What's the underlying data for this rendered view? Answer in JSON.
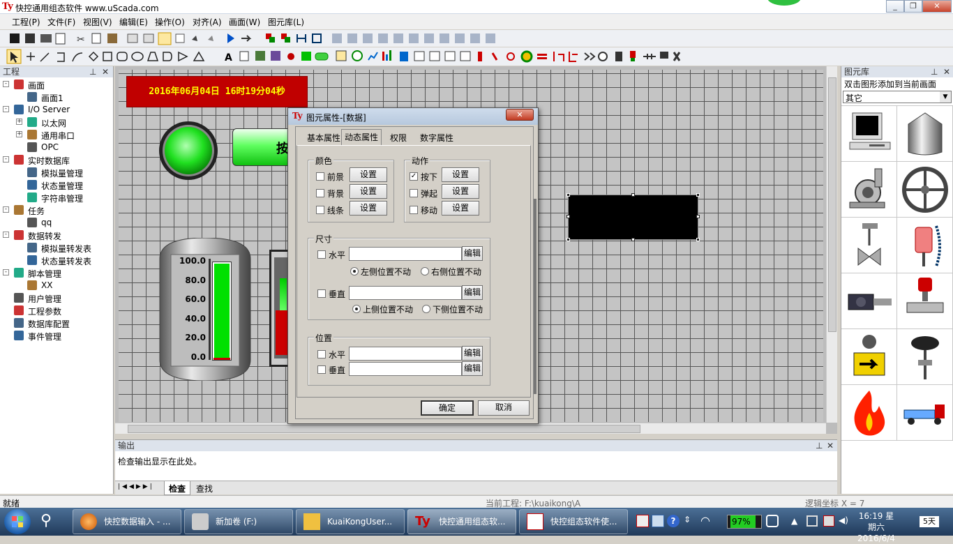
{
  "window": {
    "title": "快控通用组态软件 www.uScada.com"
  },
  "menu": [
    "工程(P)",
    "文件(F)",
    "视图(V)",
    "编辑(E)",
    "操作(O)",
    "对齐(A)",
    "画面(W)",
    "图元库(L)"
  ],
  "left_pane": {
    "title": "工程",
    "tree": [
      {
        "label": "画面",
        "level": 0,
        "expander": "-",
        "icon": "screen-icon"
      },
      {
        "label": "画面1",
        "level": 1,
        "expander": "",
        "icon": "page-icon"
      },
      {
        "label": "I/O Server",
        "level": 0,
        "expander": "-",
        "icon": "server-icon"
      },
      {
        "label": "以太网",
        "level": 1,
        "expander": "+",
        "icon": "network-icon"
      },
      {
        "label": "通用串口",
        "level": 1,
        "expander": "+",
        "icon": "serial-icon"
      },
      {
        "label": "OPC",
        "level": 1,
        "expander": "",
        "icon": "opc-icon"
      },
      {
        "label": "实时数据库",
        "level": 0,
        "expander": "-",
        "icon": "database-icon"
      },
      {
        "label": "模拟量管理",
        "level": 1,
        "expander": "",
        "icon": "analog-icon"
      },
      {
        "label": "状态量管理",
        "level": 1,
        "expander": "",
        "icon": "status-icon"
      },
      {
        "label": "字符串管理",
        "level": 1,
        "expander": "",
        "icon": "string-icon"
      },
      {
        "label": "任务",
        "level": 0,
        "expander": "-",
        "icon": "task-icon"
      },
      {
        "label": "qq",
        "level": 1,
        "expander": "",
        "icon": "qq-task-icon"
      },
      {
        "label": "数据转发",
        "level": 0,
        "expander": "-",
        "icon": "forward-icon"
      },
      {
        "label": "模拟量转发表",
        "level": 1,
        "expander": "",
        "icon": "analog-icon"
      },
      {
        "label": "状态量转发表",
        "level": 1,
        "expander": "",
        "icon": "status-icon"
      },
      {
        "label": "脚本管理",
        "level": 0,
        "expander": "-",
        "icon": "script-icon"
      },
      {
        "label": "XX",
        "level": 1,
        "expander": "",
        "icon": "page-icon"
      },
      {
        "label": "用户管理",
        "level": 0,
        "expander": "",
        "icon": "user-icon"
      },
      {
        "label": "工程参数",
        "level": 0,
        "expander": "",
        "icon": "param-icon"
      },
      {
        "label": "数据库配置",
        "level": 0,
        "expander": "",
        "icon": "dbconfig-icon"
      },
      {
        "label": "事件管理",
        "level": 0,
        "expander": "",
        "icon": "event-icon"
      }
    ]
  },
  "canvas": {
    "datetime": "2016年06月04日  16时19分04秒",
    "button_text": "按",
    "tank": {
      "ticks": [
        "100.0",
        "80.0",
        "60.0",
        "40.0",
        "20.0",
        "0.0"
      ],
      "level_percent": 100,
      "color": "#00e000"
    }
  },
  "dialog": {
    "title": "图元属性-[数据]",
    "tabs": [
      "基本属性",
      "动态属性",
      "权限",
      "数字属性"
    ],
    "active_tab": 1,
    "color": {
      "legend": "颜色",
      "items": [
        {
          "label": "前景",
          "checked": false
        },
        {
          "label": "背景",
          "checked": false
        },
        {
          "label": "线条",
          "checked": false
        }
      ],
      "button": "设置"
    },
    "action": {
      "legend": "动作",
      "items": [
        {
          "label": "按下",
          "checked": true
        },
        {
          "label": "弹起",
          "checked": false
        },
        {
          "label": "移动",
          "checked": false
        }
      ],
      "button": "设置"
    },
    "size": {
      "legend": "尺寸",
      "horizontal": "水平",
      "vertical": "垂直",
      "edit": "编辑",
      "h_left": "左侧位置不动",
      "h_right": "右侧位置不动",
      "v_top": "上侧位置不动",
      "v_bottom": "下侧位置不动"
    },
    "position": {
      "legend": "位置",
      "horizontal": "水平",
      "vertical": "垂直",
      "edit": "编辑"
    },
    "ok": "确定",
    "cancel": "取消"
  },
  "right_pane": {
    "title": "图元库",
    "hint": "双击图形添加到当前画面",
    "category": "其它"
  },
  "output": {
    "title": "输出",
    "text": "检查输出显示在此处。",
    "tabs": [
      "检查",
      "查找"
    ]
  },
  "status": {
    "left": "就绪",
    "project": "当前工程: F:\\kuaikong\\A",
    "coords": "逻辑坐标 X = 7"
  },
  "taskbar": {
    "items": [
      "快控数据输入 - ...",
      "新加卷 (F:)",
      "KuaiKongUser...",
      "快控通用组态软...",
      "快控组态软件使..."
    ],
    "battery": "97%",
    "time": "16:19",
    "date": "2016/6/4",
    "weekday": "星期六",
    "days": "5天"
  }
}
